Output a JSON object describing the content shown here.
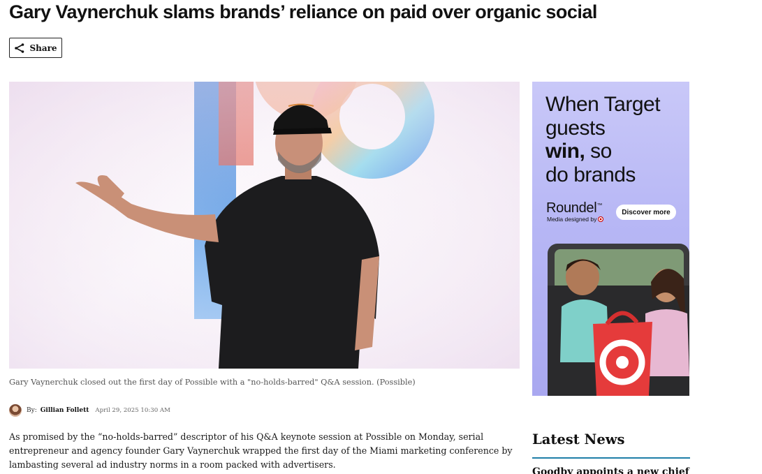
{
  "article": {
    "headline": "Gary Vaynerchuk slams brands’ reliance on paid over organic social",
    "share_label": "Share",
    "image_caption": "Gary Vaynerchuk closed out the first day of Possible with a \"no-holds-barred\" Q&A session. (Possible)",
    "byline": {
      "prefix": "By:",
      "author": "Gillian Follett",
      "date": "April 29, 2025 10:30 AM"
    },
    "lead_paragraph": "As promised by the “no-holds-barred” descriptor of his Q&A keynote session at Possible on Monday, serial entrepreneur and agency founder Gary Vaynerchuk wrapped the first day of the Miami marketing conference by lambasting several ad industry norms in a room packed with advertisers."
  },
  "ad": {
    "line1": "When Target",
    "line2": "guests",
    "line3_bold": "win,",
    "line3_rest": " so",
    "line4": "do brands",
    "brand": "Roundel",
    "brand_trademark": "™",
    "brand_sub": "Media designed by",
    "cta": "Discover more"
  },
  "sidebar": {
    "latest_title": "Latest News",
    "first_item": "Goodby appoints a new chief"
  },
  "colors": {
    "accent_rule": "#1f7fa8",
    "ad_background": "#b7b7f5",
    "target_red": "#cc0000"
  }
}
